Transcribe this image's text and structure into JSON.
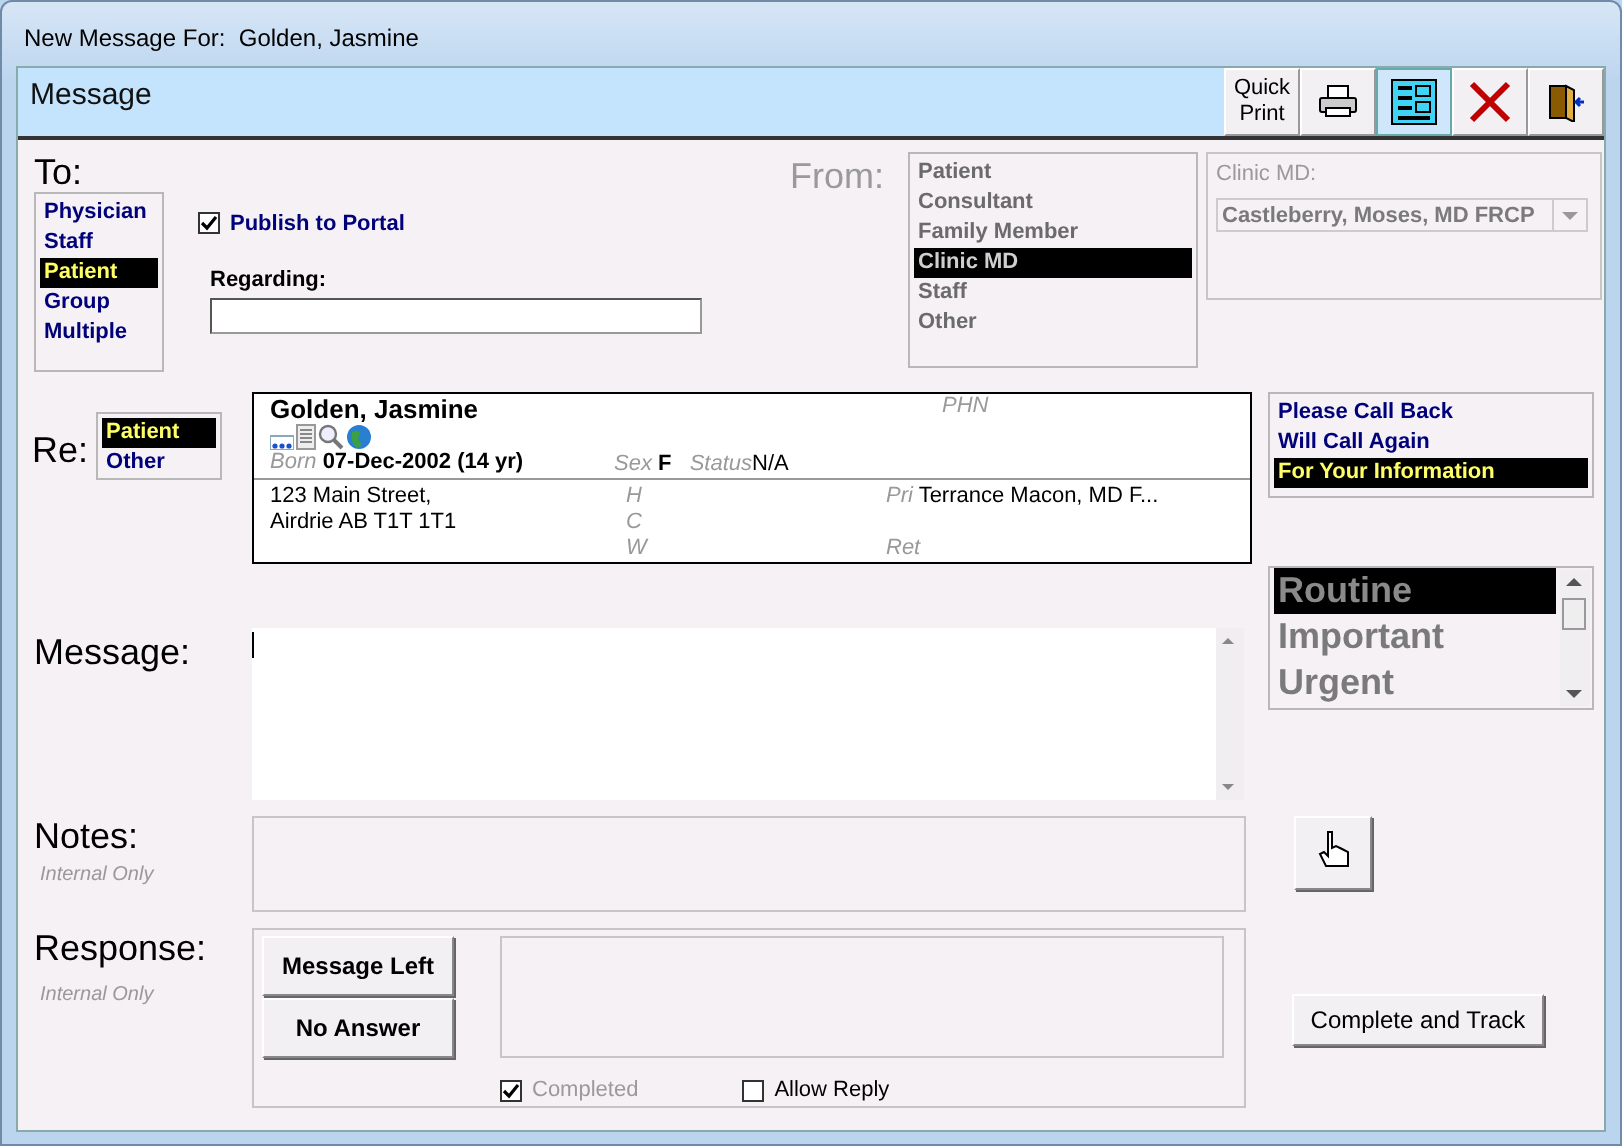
{
  "window": {
    "title": "New Message For:  Golden, Jasmine"
  },
  "header": {
    "title": "Message",
    "toolbar": [
      {
        "kind": "text",
        "label": "Quick Print"
      },
      {
        "kind": "print"
      },
      {
        "kind": "form",
        "selected": true
      },
      {
        "kind": "delete",
        "selected": false
      },
      {
        "kind": "exit",
        "selected": false
      }
    ]
  },
  "to": {
    "label": "To:",
    "options": [
      {
        "label": "Physician",
        "selected": false
      },
      {
        "label": "Staff",
        "selected": false
      },
      {
        "label": "Patient",
        "selected": true
      },
      {
        "label": "Group",
        "selected": false
      },
      {
        "label": "Multiple",
        "selected": false
      }
    ]
  },
  "publish": {
    "label": "Publish to Portal",
    "checked": true
  },
  "regarding": {
    "label": "Regarding:"
  },
  "from": {
    "label": "From:",
    "options": [
      {
        "label": "Patient",
        "selected": false
      },
      {
        "label": "Consultant",
        "selected": false
      },
      {
        "label": "Family Member",
        "selected": false
      },
      {
        "label": "Clinic MD",
        "selected": true
      },
      {
        "label": "Staff",
        "selected": false
      },
      {
        "label": "Other",
        "selected": false
      }
    ]
  },
  "clinic_md": {
    "label": "Clinic MD:",
    "value": "Castleberry, Moses, MD FRCP"
  },
  "re": {
    "label": "Re:",
    "options": [
      {
        "label": "Patient",
        "selected": true
      },
      {
        "label": "Other",
        "selected": false
      }
    ]
  },
  "patient": {
    "name": "Golden, Jasmine",
    "phn_label": "PHN",
    "born_label": "Born",
    "born": "07-Dec-2002 (14 yr)",
    "sex_label": "Sex",
    "sex": "F",
    "status_label": "Status",
    "status": "N/A",
    "address": [
      "123 Main Street,",
      "Airdrie AB  T1T 1T1"
    ],
    "phone_labels": [
      "H",
      "C",
      "W"
    ],
    "pri_label": "Pri",
    "pri": "Terrance Macon, MD F...",
    "ret_label": "Ret"
  },
  "callback": {
    "options": [
      {
        "label": "Please Call Back",
        "selected": false
      },
      {
        "label": "Will Call Again",
        "selected": false
      },
      {
        "label": "For Your Information",
        "selected": true
      }
    ]
  },
  "priority": {
    "options": [
      {
        "label": "Routine",
        "selected": true
      },
      {
        "label": "Important",
        "selected": false
      },
      {
        "label": "Urgent",
        "selected": false
      }
    ]
  },
  "message": {
    "label": "Message:"
  },
  "notes": {
    "label": "Notes:",
    "sublabel": "Internal Only"
  },
  "response": {
    "label": "Response:",
    "sublabel": "Internal Only",
    "buttons": [
      "Message Left",
      "No Answer"
    ],
    "completed": {
      "label": "Completed",
      "checked": true,
      "disabled": true
    },
    "allow_reply": {
      "label": "Allow Reply",
      "checked": false,
      "disabled": false
    }
  },
  "actions": {
    "complete": "Complete and Track"
  }
}
